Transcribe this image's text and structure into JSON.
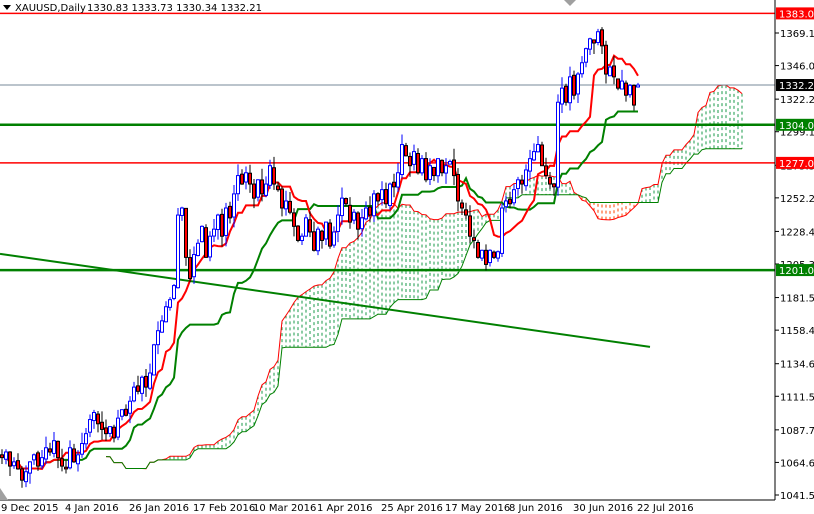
{
  "header": {
    "symbol": "XAUUSD,Daily",
    "ohlc": "1330.83 1333.73 1330.34 1332.21"
  },
  "chart_data": {
    "type": "candlestick",
    "title": "XAUUSD,Daily",
    "ylim": [
      1041.5,
      1369.1
    ],
    "y_ticks": [
      "1369.10",
      "1346.00",
      "1322.20",
      "1299.10",
      "1275.30",
      "1252.20",
      "1228.40",
      "1205.30",
      "1181.50",
      "1158.40",
      "1134.60",
      "1111.50",
      "1087.70",
      "1064.60",
      "1041.50"
    ],
    "x_ticks": [
      {
        "bar": 0,
        "label": "9 Dec 2015"
      },
      {
        "bar": 16,
        "label": "4 Jan 2016"
      },
      {
        "bar": 32,
        "label": "26 Jan 2016"
      },
      {
        "bar": 48,
        "label": "17 Feb 2016"
      },
      {
        "bar": 63,
        "label": "10 Mar 2016"
      },
      {
        "bar": 79,
        "label": "1 Apr 2016"
      },
      {
        "bar": 95,
        "label": "25 Apr 2016"
      },
      {
        "bar": 111,
        "label": "17 May 2016"
      },
      {
        "bar": 127,
        "label": "8 Jun 2016"
      },
      {
        "bar": 143,
        "label": "30 Jun 2016"
      },
      {
        "bar": 159,
        "label": "22 Jul 2016"
      }
    ],
    "closes": [
      1068,
      1072,
      1062,
      1065,
      1060,
      1052,
      1058,
      1065,
      1070,
      1062,
      1068,
      1075,
      1072,
      1080,
      1068,
      1062,
      1060,
      1075,
      1065,
      1070,
      1078,
      1085,
      1095,
      1100,
      1092,
      1088,
      1085,
      1090,
      1082,
      1096,
      1102,
      1098,
      1108,
      1118,
      1115,
      1125,
      1118,
      1128,
      1148,
      1158,
      1165,
      1175,
      1180,
      1190,
      1240,
      1245,
      1210,
      1195,
      1212,
      1220,
      1232,
      1210,
      1225,
      1230,
      1240,
      1225,
      1245,
      1238,
      1255,
      1268,
      1262,
      1270,
      1262,
      1252,
      1265,
      1255,
      1262,
      1275,
      1262,
      1258,
      1245,
      1250,
      1242,
      1232,
      1222,
      1225,
      1238,
      1228,
      1215,
      1230,
      1222,
      1235,
      1218,
      1228,
      1240,
      1252,
      1248,
      1235,
      1242,
      1230,
      1238,
      1245,
      1240,
      1255,
      1250,
      1258,
      1248,
      1262,
      1260,
      1270,
      1290,
      1282,
      1275,
      1285,
      1270,
      1280,
      1265,
      1275,
      1268,
      1280,
      1270,
      1275,
      1278,
      1268,
      1250,
      1245,
      1240,
      1225,
      1222,
      1210,
      1215,
      1205,
      1215,
      1210,
      1214,
      1245,
      1250,
      1248,
      1258,
      1265,
      1262,
      1272,
      1280,
      1285,
      1290,
      1275,
      1268,
      1262,
      1260,
      1320,
      1330,
      1320,
      1338,
      1325,
      1340,
      1348,
      1358,
      1365,
      1362,
      1370,
      1360,
      1340,
      1345,
      1338,
      1330,
      1335,
      1325,
      1332,
      1318,
      1332.21
    ],
    "last_bar": {
      "open": 1330.83,
      "high": 1333.73,
      "low": 1330.34,
      "close": 1332.21
    },
    "indicators": {
      "type": "ichimoku",
      "tenkan": 9,
      "kijun": 26,
      "senkou_b": 52
    },
    "levels": [
      {
        "price": 1383.0,
        "label": "1383.00",
        "color": "#ff0000"
      },
      {
        "price": 1304.0,
        "label": "1304.00",
        "color": "#008000"
      },
      {
        "price": 1277.0,
        "label": "1277.00",
        "color": "#ff0000"
      },
      {
        "price": 1201.0,
        "label": "1201.00",
        "color": "#008000"
      }
    ],
    "bid": {
      "price": 1332.21,
      "label": "1332.21"
    },
    "trendline": {
      "start_bar": 0,
      "start_price": 1212.5,
      "end_bar": 162,
      "end_price": 1146.5,
      "color": "#008000"
    },
    "colors": {
      "bull": "#0000ff",
      "bear": "#ff0000",
      "tenkan": "#ff0000",
      "kijun": "#008000",
      "cloud_up": "#1a9a4a",
      "cloud_down": "#ff4500"
    }
  }
}
